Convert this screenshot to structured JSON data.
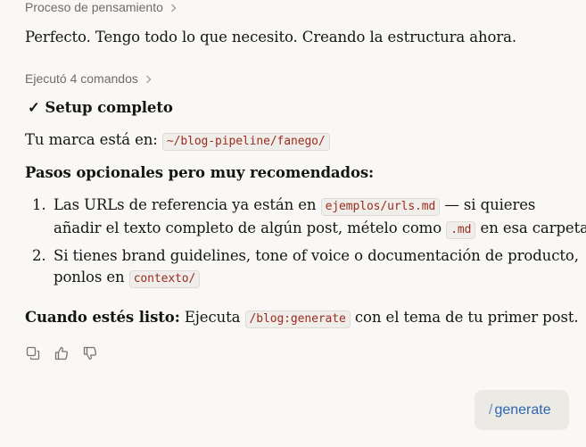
{
  "thinking": {
    "label": "Proceso de pensamiento"
  },
  "intro": "Perfecto. Tengo todo lo que necesito. Creando la estructura ahora.",
  "commands": {
    "label": "Ejecutó 4 comandos"
  },
  "setup": {
    "check": "✓",
    "label": "Setup completo"
  },
  "brand": {
    "prefix": "Tu marca está en: ",
    "path": "~/blog-pipeline/fanego/"
  },
  "optional_heading": "Pasos opcionales pero muy recomendados:",
  "steps": [
    {
      "number": "1.",
      "text_1": "Las URLs de referencia ya están en ",
      "code_1": "ejemplos/urls.md",
      "text_2": " — si quieres",
      "text_3": "añadir el texto completo de algún post, mételo como ",
      "code_2": ".md",
      "text_4": " en esa carpeta"
    },
    {
      "number": "2.",
      "text_1": "Si tienes brand guidelines, tone of voice o documentación de producto,",
      "text_2": "ponlos en ",
      "code_1": "contexto/"
    }
  ],
  "ready": {
    "bold": "Cuando estés listo:",
    "text_1": " Ejecuta ",
    "code": "/blog:generate",
    "text_2": " con el tema de tu primer post."
  },
  "actions": [
    "copy-icon",
    "thumbs-up-icon",
    "thumbs-down-icon"
  ],
  "command_chip": {
    "slash": "/",
    "label": "generate"
  }
}
